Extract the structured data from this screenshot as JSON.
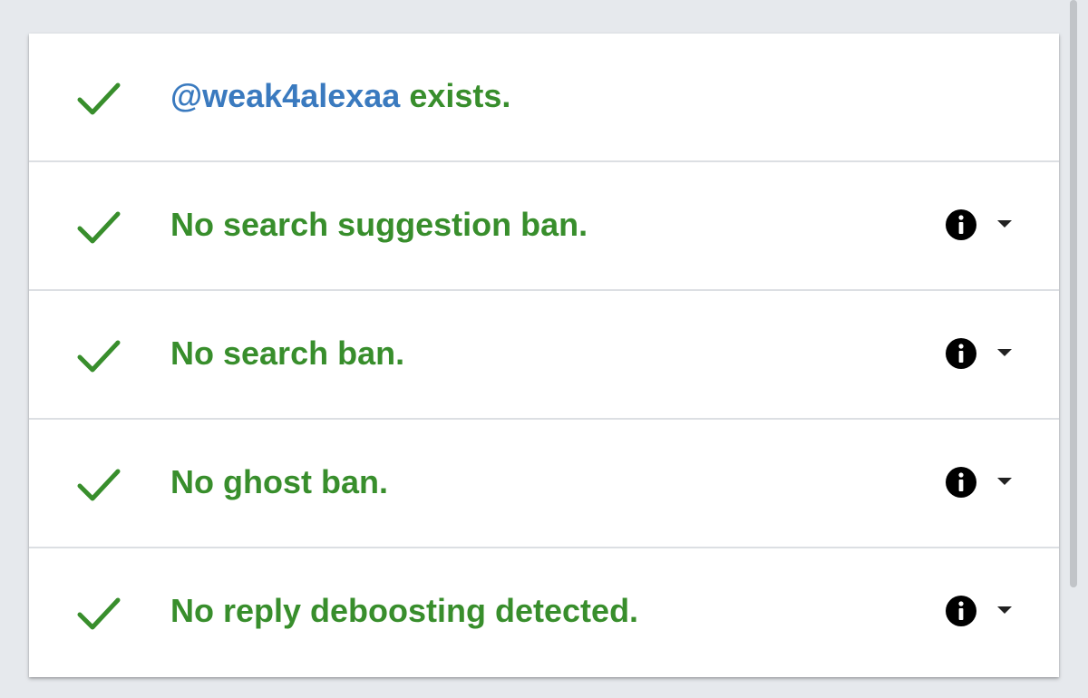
{
  "rows": [
    {
      "status_icon": "checkmark-icon",
      "handle": "@weak4alexaa",
      "message": " exists.",
      "has_info": false
    },
    {
      "status_icon": "checkmark-icon",
      "message": "No search suggestion ban.",
      "has_info": true
    },
    {
      "status_icon": "checkmark-icon",
      "message": "No search ban.",
      "has_info": true
    },
    {
      "status_icon": "checkmark-icon",
      "message": "No ghost ban.",
      "has_info": true
    },
    {
      "status_icon": "checkmark-icon",
      "message": "No reply deboosting detected.",
      "has_info": true
    }
  ],
  "colors": {
    "success_green": "#388e2c",
    "handle_blue": "#3a7abf",
    "page_background": "#e6e9ed",
    "card_background": "#ffffff",
    "divider": "#dcdfe3"
  }
}
